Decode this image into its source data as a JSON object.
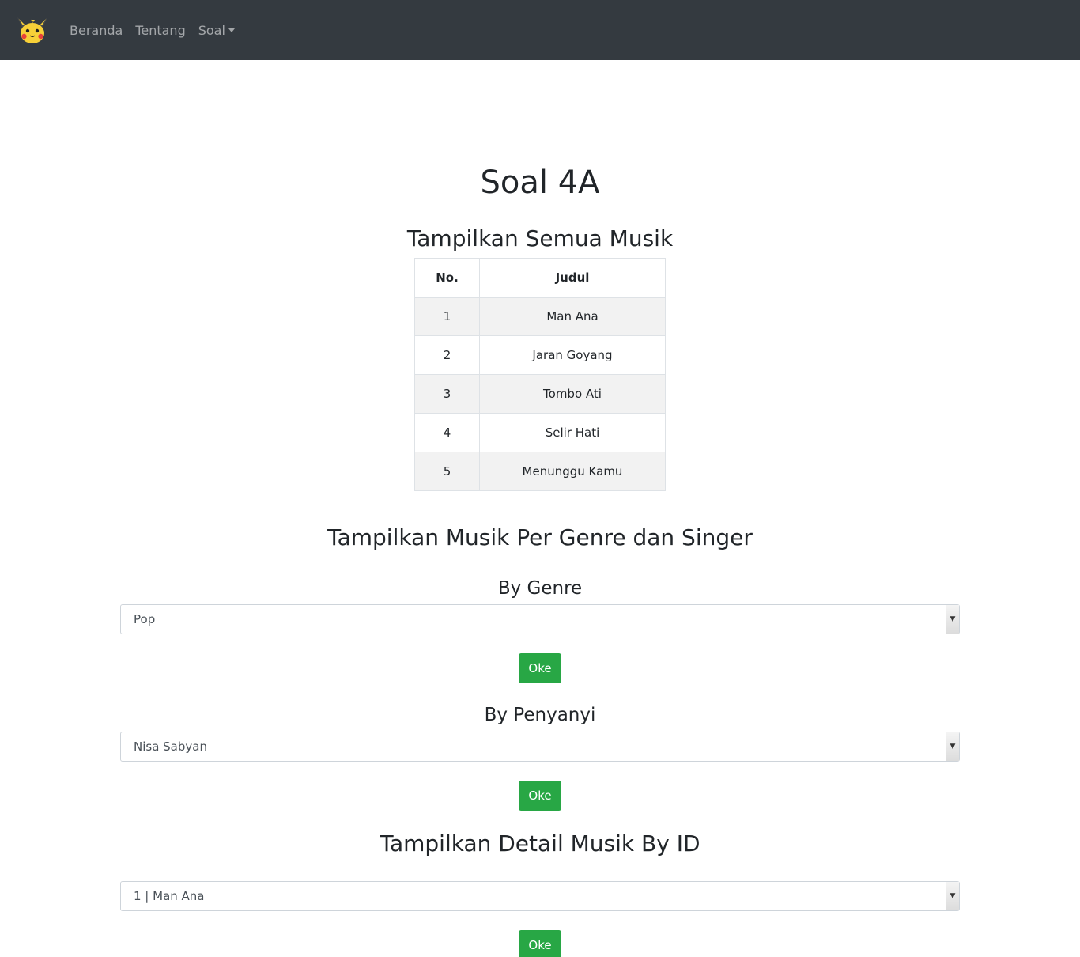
{
  "nav": {
    "logo_icon": "pikachu-logo-icon",
    "links": [
      "Beranda",
      "Tentang",
      "Soal"
    ]
  },
  "page": {
    "title": "Soal 4A"
  },
  "all_music": {
    "heading": "Tampilkan Semua Musik",
    "columns": [
      "No.",
      "Judul"
    ],
    "rows": [
      {
        "no": "1",
        "judul": "Man Ana"
      },
      {
        "no": "2",
        "judul": "Jaran Goyang"
      },
      {
        "no": "3",
        "judul": "Tombo Ati"
      },
      {
        "no": "4",
        "judul": "Selir Hati"
      },
      {
        "no": "5",
        "judul": "Menunggu Kamu"
      }
    ]
  },
  "genre_singer": {
    "heading": "Tampilkan Musik Per Genre dan Singer",
    "genre": {
      "label": "By Genre",
      "selected": "Pop",
      "button": "Oke"
    },
    "singer": {
      "label": "By Penyanyi",
      "selected": "Nisa Sabyan",
      "button": "Oke"
    }
  },
  "detail": {
    "heading": "Tampilkan Detail Musik By ID",
    "selected": "1 | Man Ana",
    "button": "Oke"
  },
  "colors": {
    "navbar": "#343a40",
    "button": "#28a745",
    "table_stripe": "#f2f2f2"
  }
}
